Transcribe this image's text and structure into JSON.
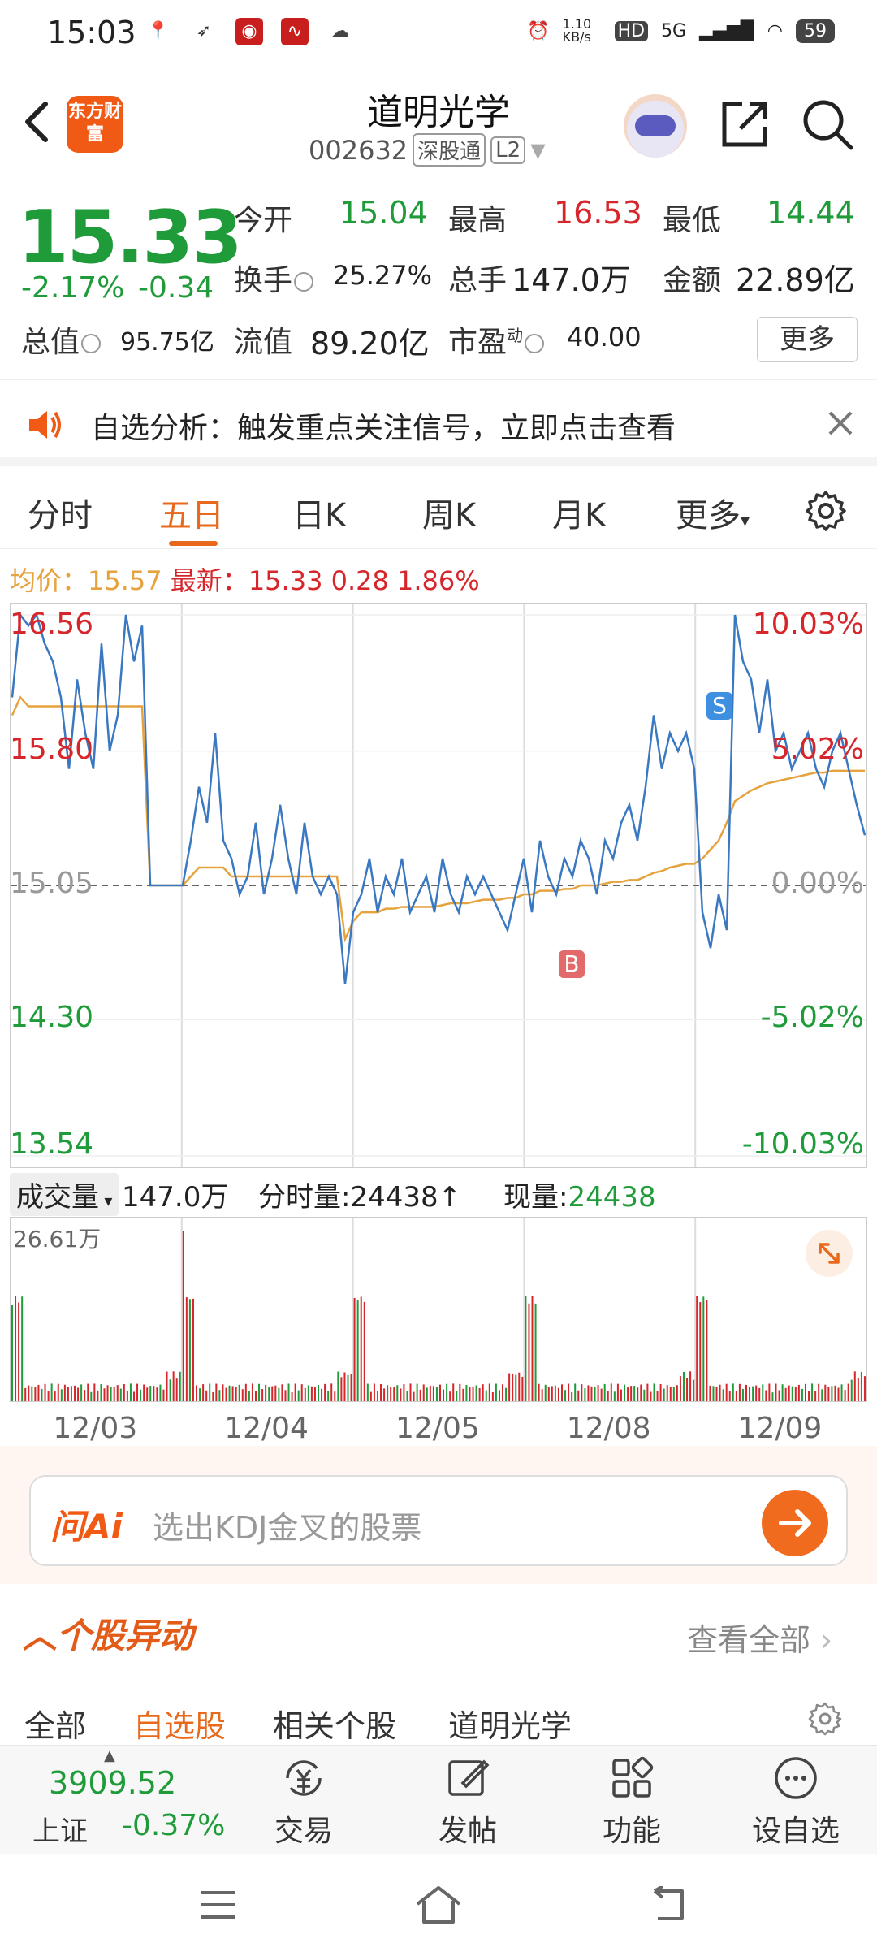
{
  "status_bar": {
    "time": "15:03",
    "net_speed": "1.10 KB/s",
    "hd": "HD",
    "signal": "5G",
    "battery": "59"
  },
  "header": {
    "logo_text": "东方财富",
    "stock_name": "道明光学",
    "stock_code": "002632",
    "tag1": "深股通",
    "tag2": "L2"
  },
  "quote": {
    "price": "15.33",
    "change_pct": "-2.17%",
    "change": "-0.34",
    "open_label": "今开",
    "open": "15.04",
    "high_label": "最高",
    "high": "16.53",
    "low_label": "最低",
    "low": "14.44",
    "turnover_label": "换手",
    "turnover": "25.27%",
    "volume_label": "总手",
    "volume": "147.0万",
    "amount_label": "金额",
    "amount": "22.89亿",
    "mktcap_label": "总值",
    "mktcap": "95.75亿",
    "float_label": "流值",
    "float": "89.20亿",
    "pe_label": "市盈",
    "pe_sup": "动",
    "pe": "40.00",
    "more_label": "更多"
  },
  "alert": {
    "text": "自选分析：触发重点关注信号，立即点击查看"
  },
  "tabs": [
    "分时",
    "五日",
    "日K",
    "周K",
    "月K",
    "更多"
  ],
  "active_tab": "五日",
  "avg_line": {
    "avg_label": "均价：",
    "avg": "15.57",
    "latest_label": "最新：",
    "latest": "15.33",
    "diff": "0.28",
    "diff_pct": "1.86%"
  },
  "chart_data": {
    "type": "line",
    "left_ticks": [
      "16.56",
      "15.80",
      "15.05",
      "14.30",
      "13.54"
    ],
    "right_ticks": [
      "10.03%",
      "5.02%",
      "0.00%",
      "-5.02%",
      "-10.03%"
    ],
    "ylim": [
      13.54,
      16.56
    ],
    "baseline": 15.05,
    "days": [
      "12/03",
      "12/04",
      "12/05",
      "12/08",
      "12/09"
    ],
    "series": [
      {
        "values": [
          16.1,
          16.56,
          16.5,
          16.56,
          16.4,
          16.3,
          16.1,
          15.7,
          16.2,
          15.9,
          15.7,
          16.4,
          15.8,
          16.0,
          16.56,
          16.3,
          16.5,
          15.05,
          15.05,
          15.05,
          15.05,
          15.05,
          15.3,
          15.6,
          15.4,
          15.9,
          15.3,
          15.2,
          15.0,
          15.1,
          15.4,
          15.0,
          15.2,
          15.5,
          15.2,
          15.0,
          15.4,
          15.1,
          15.0,
          15.1,
          15.0,
          14.5,
          14.9,
          15.0,
          15.2,
          14.9,
          15.1,
          15.0,
          15.2,
          14.9,
          15.0,
          15.1,
          14.9,
          15.2,
          15.0,
          14.9,
          15.1,
          15.0,
          15.1,
          15.0,
          14.9,
          14.8,
          15.0,
          15.2,
          14.9,
          15.3,
          15.1,
          15.0,
          15.2,
          15.1,
          15.3,
          15.2,
          15.0,
          15.3,
          15.2,
          15.4,
          15.5,
          15.3,
          15.6,
          16.0,
          15.7,
          15.9,
          15.8,
          15.9,
          15.7,
          14.9,
          14.7,
          15.0,
          14.8,
          16.56,
          16.3,
          16.2,
          15.9,
          16.2,
          15.8,
          15.9,
          15.7,
          15.8,
          15.9,
          15.7,
          15.6,
          15.8,
          15.9,
          15.7,
          15.5,
          15.33
        ],
        "avg": [
          16.0,
          16.1,
          16.05,
          16.05,
          16.05,
          16.05,
          16.05,
          16.05,
          16.05,
          16.05,
          16.05,
          16.05,
          16.05,
          16.05,
          16.05,
          16.05,
          16.05,
          15.05,
          15.05,
          15.05,
          15.05,
          15.05,
          15.1,
          15.15,
          15.15,
          15.15,
          15.15,
          15.1,
          15.1,
          15.1,
          15.1,
          15.1,
          15.1,
          15.1,
          15.1,
          15.1,
          15.1,
          15.1,
          15.1,
          15.1,
          15.1,
          14.75,
          14.85,
          14.9,
          14.9,
          14.9,
          14.92,
          14.92,
          14.93,
          14.93,
          14.93,
          14.93,
          14.93,
          14.94,
          14.95,
          14.95,
          14.95,
          14.96,
          14.97,
          14.97,
          14.97,
          14.98,
          14.98,
          15.0,
          15.0,
          15.02,
          15.02,
          15.02,
          15.03,
          15.03,
          15.05,
          15.05,
          15.05,
          15.06,
          15.07,
          15.07,
          15.08,
          15.08,
          15.1,
          15.12,
          15.13,
          15.15,
          15.16,
          15.17,
          15.17,
          15.2,
          15.25,
          15.3,
          15.4,
          15.52,
          15.55,
          15.58,
          15.6,
          15.62,
          15.63,
          15.64,
          15.65,
          15.66,
          15.67,
          15.68,
          15.68,
          15.69,
          15.69,
          15.69,
          15.69,
          15.69
        ]
      }
    ]
  },
  "volume": {
    "select_label": "成交量",
    "total": "147.0万",
    "tick_label": "分时量:",
    "tick_value": "24438",
    "arrow": "↑",
    "now_label": "现量:",
    "now_value": "24438",
    "max": "26.61万"
  },
  "ai": {
    "logo": "问Ai",
    "placeholder": "选出KDJ金叉的股票"
  },
  "movement": {
    "title": "个股异动",
    "view_all": "查看全部",
    "subtabs": [
      "全部",
      "自选股",
      "相关个股",
      "道明光学"
    ],
    "active_subtab": "自选股"
  },
  "bottom": {
    "index_value": "3909.52",
    "index_name": "上证",
    "index_change": "-0.37%",
    "nav": [
      "交易",
      "发帖",
      "功能",
      "设自选"
    ]
  },
  "colors": {
    "accent": "#e8691c",
    "up": "#d7262b",
    "down": "#1f9b3a",
    "price_line": "#3a78c2",
    "avg_line": "#e6a23c"
  }
}
